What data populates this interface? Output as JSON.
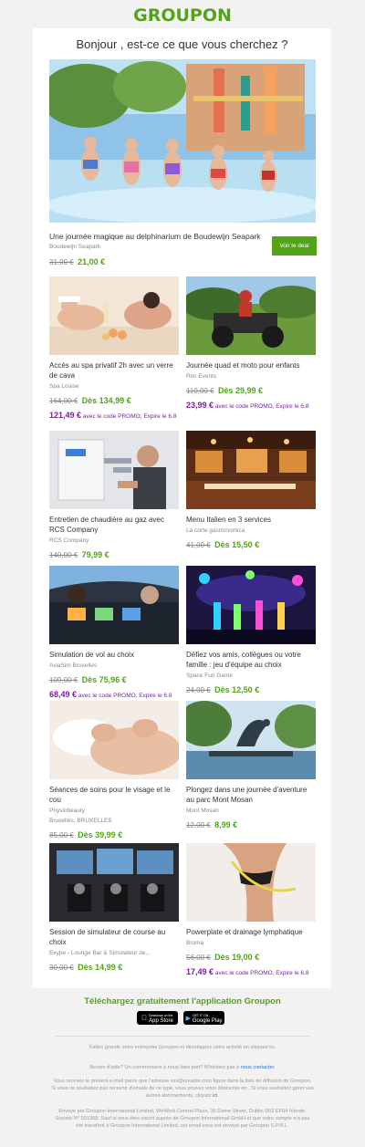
{
  "header": {
    "logo_text": "GROUPON"
  },
  "greeting": "Bonjour , est-ce ce que vous cherchez ?",
  "hero": {
    "image": "waterpark-kids-photo",
    "title": "Une journée magique au delphinarium de Boudewijn Seapark",
    "merchant": "Boudewijn Seapark",
    "old_price": "31,00 €",
    "new_price": "21,00 €",
    "button_label": "Voir le deal"
  },
  "deals": [
    {
      "image": "spa-couple-photo",
      "title": "Accès au spa privatif 2h avec un verre de cava",
      "merchant": "Spa Louise",
      "old_price": "164,00 €",
      "new_price": "Dès 134,99 €",
      "promo_price": "121,49 €",
      "promo_text": " avec le code PROMO, Expire le 6.8"
    },
    {
      "image": "quad-bike-photo",
      "title": "Journée quad et moto pour enfants",
      "merchant": "Roc Events",
      "old_price": "110,00 €",
      "new_price": "Dès 29,99 €",
      "promo_price": "23,99 €",
      "promo_text": " avec le code PROMO, Expire le 6.8"
    },
    {
      "image": "boiler-repair-photo",
      "title": "Entretien de chaudière au gaz avec RCS Company",
      "merchant": "RCS Company",
      "old_price": "140,00 €",
      "new_price": "79,99 €"
    },
    {
      "image": "italian-restaurant-photo",
      "title": "Menu Italien en 3 services",
      "merchant": "La corte gastronomica",
      "old_price": "41,00 €",
      "new_price": "Dès 15,50 €"
    },
    {
      "image": "flight-simulator-photo",
      "title": "Simulation de vol au choix",
      "merchant": "AviaSim Bruxelles",
      "old_price": "109,00 €",
      "new_price": "Dès 75,96 €",
      "promo_price": "68,49 €",
      "promo_text": " avec le code PROMO, Expire le 6.8"
    },
    {
      "image": "laser-game-photo",
      "title": "Défiez vos amis, collègues ou votre famille : jeu d'équipe au choix",
      "merchant": "Space Fun Game",
      "old_price": "24,00 €",
      "new_price": "Dès 12,50 €"
    },
    {
      "image": "massage-photo",
      "title": "Séances de soins pour le visage et le cou",
      "merchant": "Physiobeauty",
      "merchant2": "Bruxelles, BRUXELLES",
      "old_price": "85,00 €",
      "new_price": "Dès 39,99 €"
    },
    {
      "image": "sea-lion-park-photo",
      "title": "Plongez dans une journée d'aventure au parc Mont Mosan",
      "merchant": "Mont Mosan",
      "old_price": "12,00 €",
      "new_price": "8,99 €"
    },
    {
      "image": "racing-simulator-photo",
      "title": "Session de simulateur de course au choix",
      "merchant": "Exype - Lounge Bar & Simulateur de...",
      "old_price": "30,00 €",
      "new_price": "Dès 14,99 €"
    },
    {
      "image": "body-measure-photo",
      "title": "Powerplate et drainage lymphatique",
      "merchant": "Bruma",
      "old_price": "56,00 €",
      "new_price": "Dès 19,00 €",
      "promo_price": "17,49 €",
      "promo_text": " avec le code PROMO, Expire le 6.8"
    }
  ],
  "app": {
    "title": "Téléchargez gratuitement l'application Groupon",
    "appstore_small": "Download on the",
    "appstore_big": "App Store",
    "googleplay_small": "GET IT ON",
    "googleplay_big": "Google Play"
  },
  "footer": {
    "grow": "Faites grandir votre entreprise Groupon et développez votre activité en cliquant ici.",
    "help_prefix": "Besoin d'aide? Un commentaire à nous faire part? N'hésitez pas à ",
    "help_link": "nous contacter",
    "help_suffix": ".",
    "notice": "Vous recevez le présent e-mail parce que l'adresse xxx@ureader.com figure dans la liste de diffusion de Groupon. Si vous ne souhaitez pas recevoir d'emails de ce type, vous pouvez vous désincrire en . Si vous souhaitez gérer vos autres abonnements, cliquez ",
    "notice_link": "ici",
    "legal": "Envoyé par Groupon International Limited, WeWork Central Plaza, 36 Dame Street, Dublin D02 EF64 Irlande. Société N° 501358. Sauf si vous êtes inscrit auprès de Groupon International GmbH et que votre compte n'a pas été transféré à Groupon International Limited, cet email vous est envoyé par Groupon S.P.R.L."
  }
}
